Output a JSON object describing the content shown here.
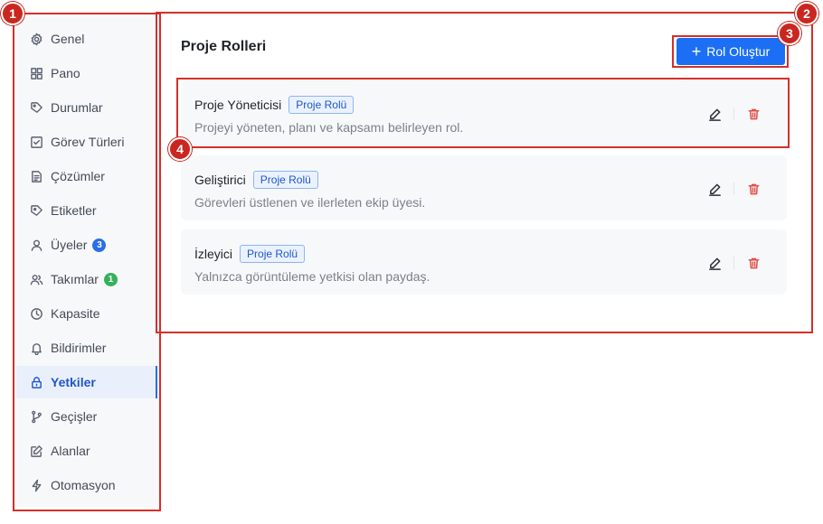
{
  "sidebar": {
    "items": [
      {
        "label": "Genel",
        "icon": "gear-icon"
      },
      {
        "label": "Pano",
        "icon": "grid-icon"
      },
      {
        "label": "Durumlar",
        "icon": "tag-icon"
      },
      {
        "label": "Görev Türleri",
        "icon": "checkbox-icon"
      },
      {
        "label": "Çözümler",
        "icon": "document-icon"
      },
      {
        "label": "Etiketler",
        "icon": "label-icon"
      },
      {
        "label": "Üyeler",
        "icon": "user-icon",
        "badge": "3"
      },
      {
        "label": "Takımlar",
        "icon": "team-icon",
        "badge": "1"
      },
      {
        "label": "Kapasite",
        "icon": "clock-icon"
      },
      {
        "label": "Bildirimler",
        "icon": "bell-icon"
      },
      {
        "label": "Yetkiler",
        "icon": "lock-icon",
        "active": true
      },
      {
        "label": "Geçişler",
        "icon": "branch-icon"
      },
      {
        "label": "Alanlar",
        "icon": "edit-square-icon"
      },
      {
        "label": "Otomasyon",
        "icon": "lightning-icon"
      }
    ]
  },
  "main": {
    "title": "Proje Rolleri",
    "create_button": "Rol Oluştur",
    "roles": [
      {
        "name": "Proje Yöneticisi",
        "tag": "Proje Rolü",
        "description": "Projeyi yöneten, planı ve kapsamı belirleyen rol."
      },
      {
        "name": "Geliştirici",
        "tag": "Proje Rolü",
        "description": "Görevleri üstlenen ve ilerleten ekip üyesi."
      },
      {
        "name": "İzleyici",
        "tag": "Proje Rolü",
        "description": "Yalnızca görüntüleme yetkisi olan paydaş."
      }
    ]
  },
  "annotations": {
    "markers": [
      "1",
      "2",
      "3",
      "4"
    ]
  },
  "colors": {
    "accent": "#1c6ff5",
    "annotation": "#d32f2a",
    "badge_blue": "#2b6de5",
    "badge_green": "#34b15b"
  }
}
